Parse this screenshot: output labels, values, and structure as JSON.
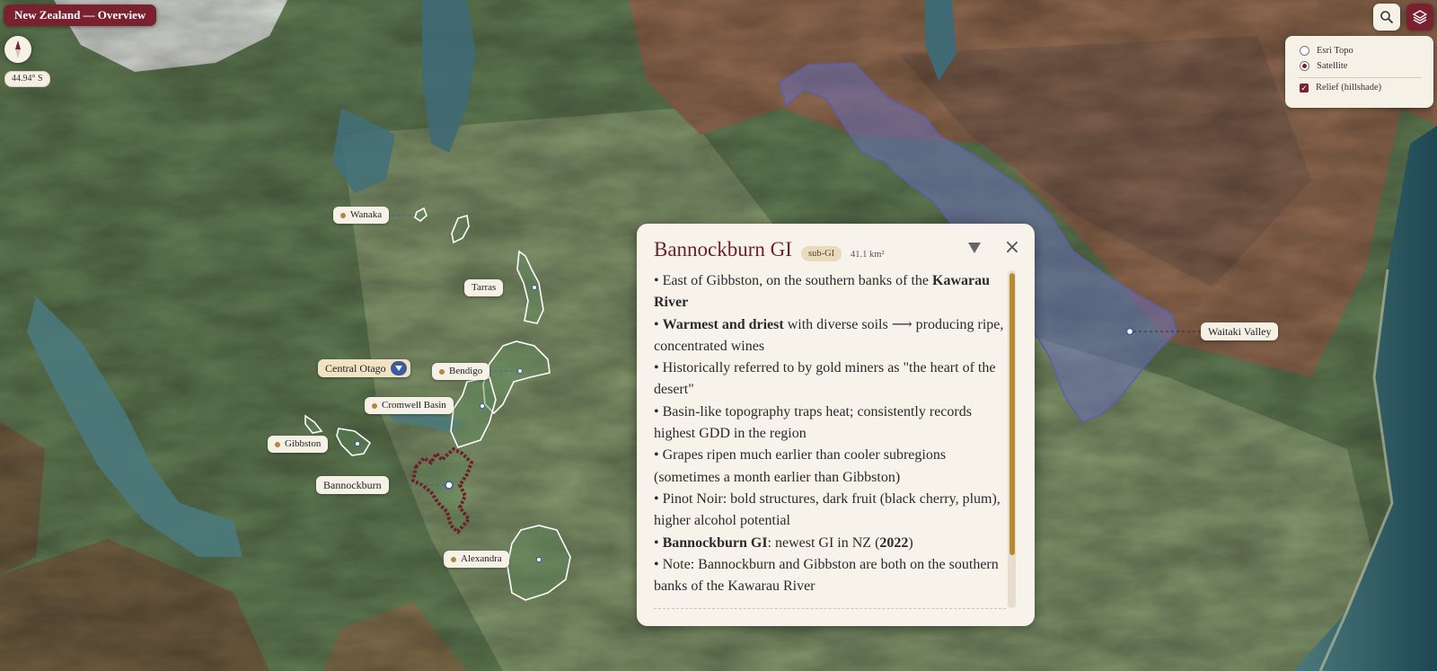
{
  "map": {
    "title": "New Zealand — Overview",
    "latitude_readout": "44.94° S"
  },
  "toolbar": {
    "search_icon": "search-icon",
    "layers_icon": "layers-icon"
  },
  "layers": {
    "basemaps": [
      {
        "label": "Esri Topo",
        "selected": false
      },
      {
        "label": "Satellite",
        "selected": true
      }
    ],
    "overlays": [
      {
        "label": "Relief (hillshade)",
        "checked": true
      }
    ]
  },
  "places": {
    "wanaka": "Wanaka",
    "tarras": "Tarras",
    "central_otago": "Central Otago",
    "bendigo": "Bendigo",
    "cromwell_basin": "Cromwell Basin",
    "gibbston": "Gibbston",
    "bannockburn": "Bannockburn",
    "alexandra": "Alexandra",
    "waitaki_valley": "Waitaki Valley"
  },
  "popup": {
    "title": "Bannockburn GI",
    "badge": "sub-GI",
    "area": "41.1 km²",
    "lines": [
      {
        "pre": "• East of Gibbston, on the southern banks of the ",
        "bold": "Kawarau River",
        "post": ""
      },
      {
        "pre": "• ",
        "bold": "Warmest and driest",
        "post": " with diverse soils ⟶ producing ripe, concentrated wines"
      },
      {
        "pre": "• Historically referred to by gold miners as \"the heart of the desert\"",
        "bold": "",
        "post": ""
      },
      {
        "pre": "• Basin-like topography traps heat; consistently records highest GDD in the region",
        "bold": "",
        "post": ""
      },
      {
        "pre": "• Grapes ripen much earlier than cooler subregions (sometimes a month earlier than Gibbston)",
        "bold": "",
        "post": ""
      },
      {
        "pre": "• Pinot Noir: bold structures, dark fruit (black cherry, plum), higher alcohol potential",
        "bold": "",
        "post": ""
      },
      {
        "pre": "• ",
        "bold": "Bannockburn GI",
        "post": ": newest GI in NZ ("
      },
      {
        "pre": "• Note: Bannockburn and Gibbston are both on the southern banks of the Kawarau River",
        "bold": "",
        "post": ""
      }
    ],
    "year": "2022",
    "year_close": ")"
  },
  "colors": {
    "brand": "#7a2130",
    "panel": "#f6f1e6",
    "waitaki_fill": "#6a6fb8",
    "subregion_fill": "#5e8a5a",
    "highlight_outline": "#6d1f2a"
  }
}
